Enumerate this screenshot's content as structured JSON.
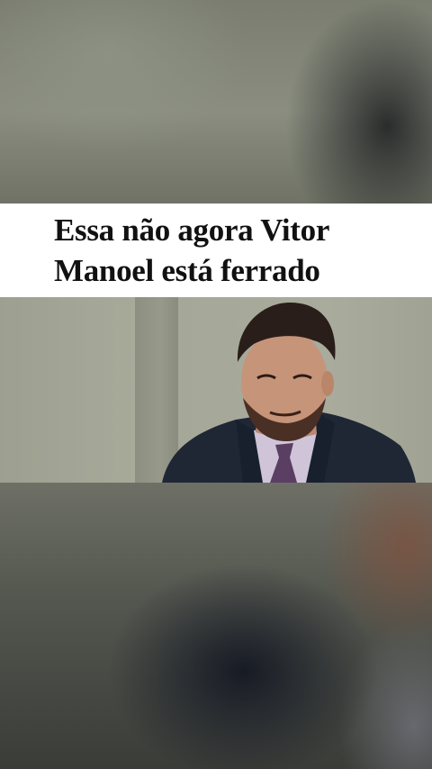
{
  "caption": {
    "line1": "Essa não agora Vitor",
    "line2": "Manoel está ferrado"
  },
  "colors": {
    "caption_background": "#ffffff",
    "caption_text": "#111111"
  }
}
